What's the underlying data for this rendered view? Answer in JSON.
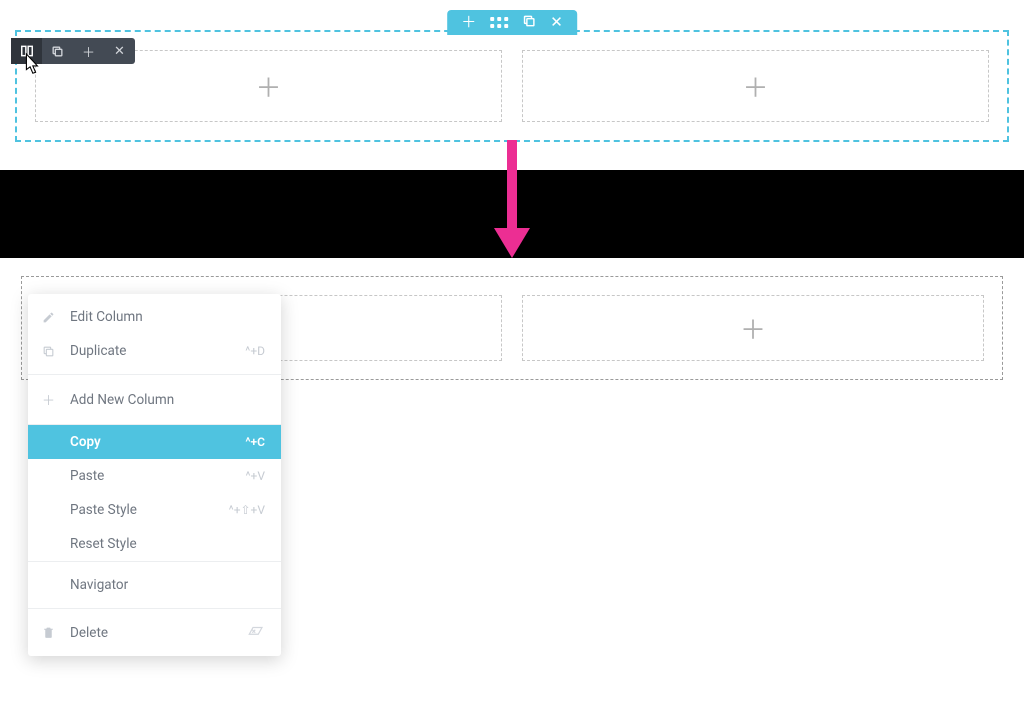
{
  "contextMenu": {
    "editColumn": "Edit Column",
    "duplicate": "Duplicate",
    "duplicateShortcut": "^+D",
    "addNewColumn": "Add New Column",
    "copy": "Copy",
    "copyShortcut": "^+C",
    "paste": "Paste",
    "pasteShortcut": "^+V",
    "pasteStyle": "Paste Style",
    "pasteStyleShortcut": "^+⇧+V",
    "resetStyle": "Reset Style",
    "navigator": "Navigator",
    "delete": "Delete"
  }
}
